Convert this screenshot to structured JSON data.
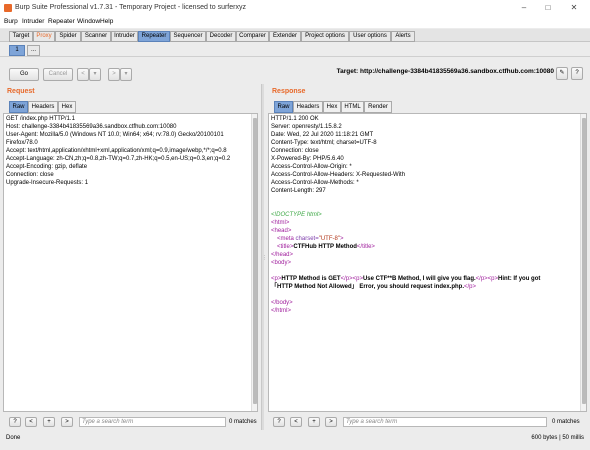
{
  "window": {
    "title": "Burp Suite Professional v1.7.31 - Temporary Project - licensed to surferxyz"
  },
  "menu": [
    "Burp",
    "Intruder",
    "Repeater",
    "Window",
    "Help"
  ],
  "tabs": [
    "Target",
    "Proxy",
    "Spider",
    "Scanner",
    "Intruder",
    "Repeater",
    "Sequencer",
    "Decoder",
    "Comparer",
    "Extender",
    "Project options",
    "User options",
    "Alerts"
  ],
  "active_tab": "Repeater",
  "subtabs": [
    "1",
    "..."
  ],
  "controls": {
    "go": "Go",
    "cancel": "Cancel",
    "back": "<",
    "forward": ">",
    "dropdown": "▾",
    "target_label": "Target: http://challenge-3384b41835569a36.sandbox.ctfhub.com:10080",
    "help": "?"
  },
  "request": {
    "heading": "Request",
    "tabs": [
      "Raw",
      "Headers",
      "Hex"
    ],
    "lines": [
      "GET /index.php HTTP/1.1",
      "Host: challenge-3384b41835569a36.sandbox.ctfhub.com:10080",
      "User-Agent: Mozilla/5.0 (Windows NT 10.0; Win64; x64; rv:78.0) Gecko/20100101",
      "Firefox/78.0",
      "Accept: text/html,application/xhtml+xml,application/xml;q=0.9,image/webp,*/*;q=0.8",
      "Accept-Language: zh-CN,zh;q=0.8,zh-TW;q=0.7,zh-HK;q=0.5,en-US;q=0.3,en;q=0.2",
      "Accept-Encoding: gzip, deflate",
      "Connection: close",
      "Upgrade-Insecure-Requests: 1"
    ],
    "search_placeholder": "Type a search term",
    "matches": "0 matches"
  },
  "response": {
    "heading": "Response",
    "tabs": [
      "Raw",
      "Headers",
      "Hex",
      "HTML",
      "Render"
    ],
    "header_lines": [
      "HTTP/1.1 200 OK",
      "Server: openresty/1.15.8.2",
      "Date: Wed, 22 Jul 2020 11:18:21 GMT",
      "Content-Type: text/html; charset=UTF-8",
      "Connection: close",
      "X-Powered-By: PHP/5.6.40",
      "Access-Control-Allow-Origin: *",
      "Access-Control-Allow-Headers: X-Requested-With",
      "Access-Control-Allow-Methods: *",
      "Content-Length: 297"
    ],
    "html": {
      "doctype": "<!DOCTYPE html>",
      "html_open": "<html>",
      "head_open": "<head>",
      "meta_open": "<meta",
      "meta_attr": "charset=",
      "meta_val": "\"UTF-8\"",
      "meta_close": ">",
      "title_open": "<title>",
      "title_text": "CTFHub HTTP Method",
      "title_close": "</title>",
      "head_close": "</head>",
      "body_open": "<body>",
      "p1_open": "<p>",
      "p1_text": "HTTP Method is GET",
      "p1_close": "</p>",
      "p2_open": "<p>",
      "p2_text": "Use CTF**B Method, I will give you flag.",
      "p2_close": "</p>",
      "p3_open": "<p>",
      "p3_text": "Hint: If you got",
      "p3_text2": "「HTTP Method Not Allowed」 Error, you should request index.php.",
      "p3_close": "</p>",
      "body_close": "</body>",
      "html_close": "</html>"
    },
    "search_placeholder": "Type a search term",
    "matches": "0 matches"
  },
  "status": {
    "left": "Done",
    "right": "600 bytes | 50 millis"
  },
  "colors": {
    "accent": "#e8692a",
    "active_tab": "#7ea4d8"
  }
}
